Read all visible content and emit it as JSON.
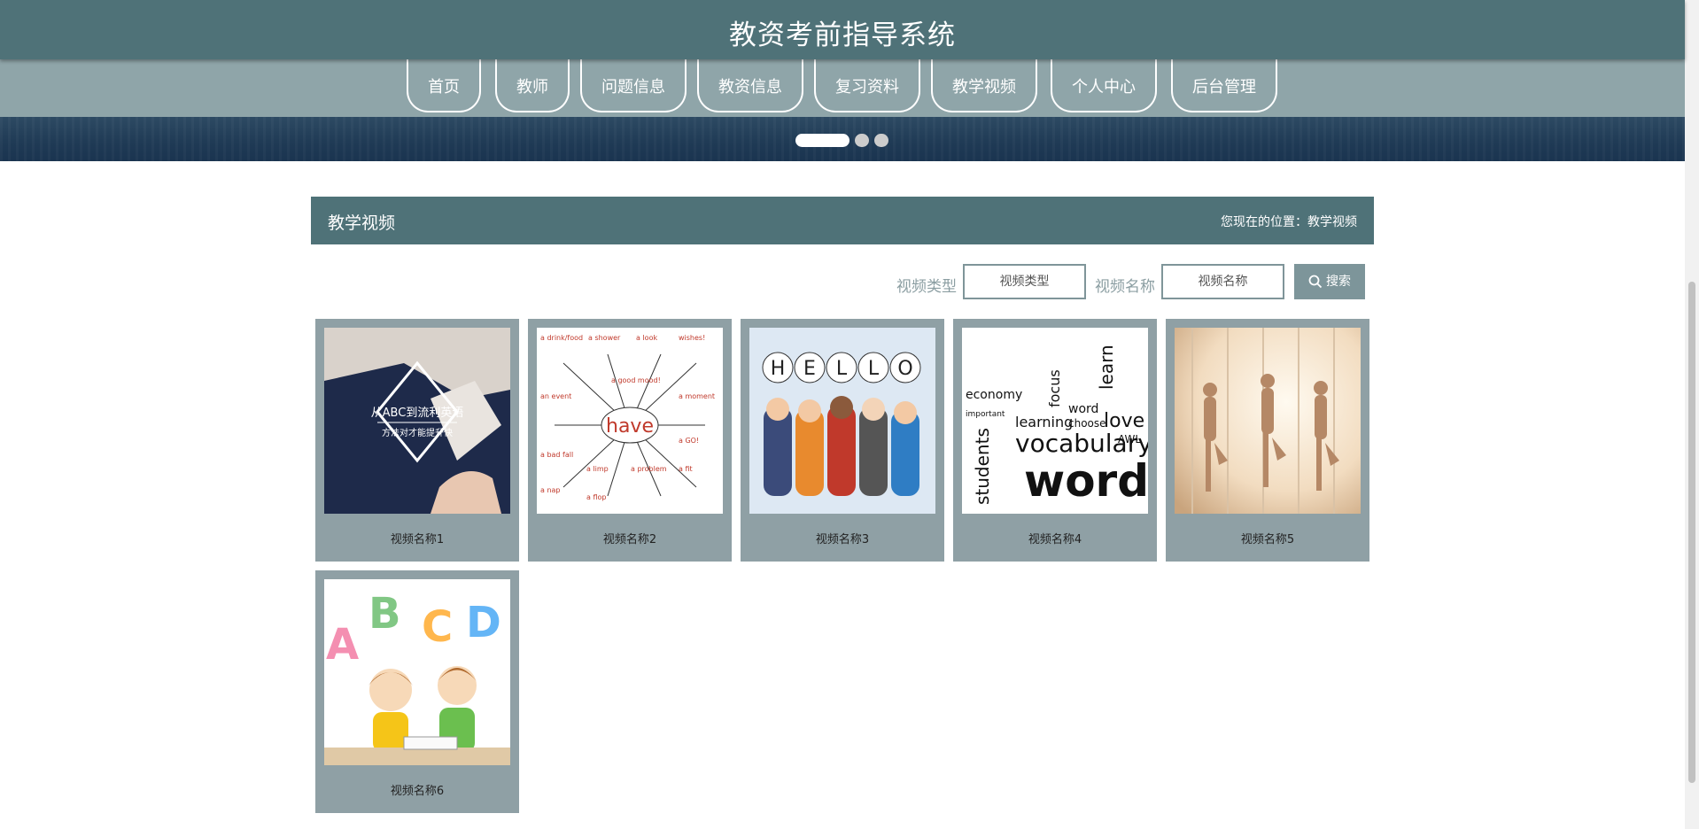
{
  "header": {
    "title": "教资考前指导系统"
  },
  "nav": {
    "items": [
      "首页",
      "教师",
      "问题信息",
      "教资信息",
      "复习资料",
      "教学视频",
      "个人中心",
      "后台管理"
    ]
  },
  "section": {
    "title": "教学视频",
    "breadcrumb": "您现在的位置：教学视频"
  },
  "search": {
    "type_label": "视频类型",
    "type_placeholder": "视频类型",
    "name_label": "视频名称",
    "name_placeholder": "视频名称",
    "button_label": "搜索"
  },
  "videos": [
    {
      "name": "视频名称1",
      "thumb_text_1": "从ABC到流利英语",
      "thumb_text_2": "方法对才能提升快"
    },
    {
      "name": "视频名称2",
      "thumb_text_1": "have",
      "thumb_tags": [
        "a drink/food",
        "a shower",
        "a look",
        "wishes!",
        "a good mood!",
        "an event",
        "a moment",
        "a bad fall",
        "a limp",
        "a problem",
        "a fit",
        "a nap",
        "a flop",
        "a GO!"
      ]
    },
    {
      "name": "视频名称3",
      "thumb_letters": [
        "H",
        "E",
        "L",
        "L",
        "O"
      ]
    },
    {
      "name": "视频名称4",
      "thumb_words": [
        "vocabulary",
        "words",
        "students",
        "learning",
        "economy",
        "focus",
        "love",
        "choose",
        "word",
        "learn",
        "important",
        "AWL"
      ]
    },
    {
      "name": "视频名称5"
    },
    {
      "name": "视频名称6",
      "thumb_letters": [
        "A",
        "B",
        "C",
        "D"
      ]
    }
  ],
  "carousel": {
    "count": 3,
    "active": 0
  },
  "colors": {
    "header": "#4f7278",
    "nav": "#8fa5a9",
    "card": "#8fa0a5",
    "button": "#7d959a"
  }
}
